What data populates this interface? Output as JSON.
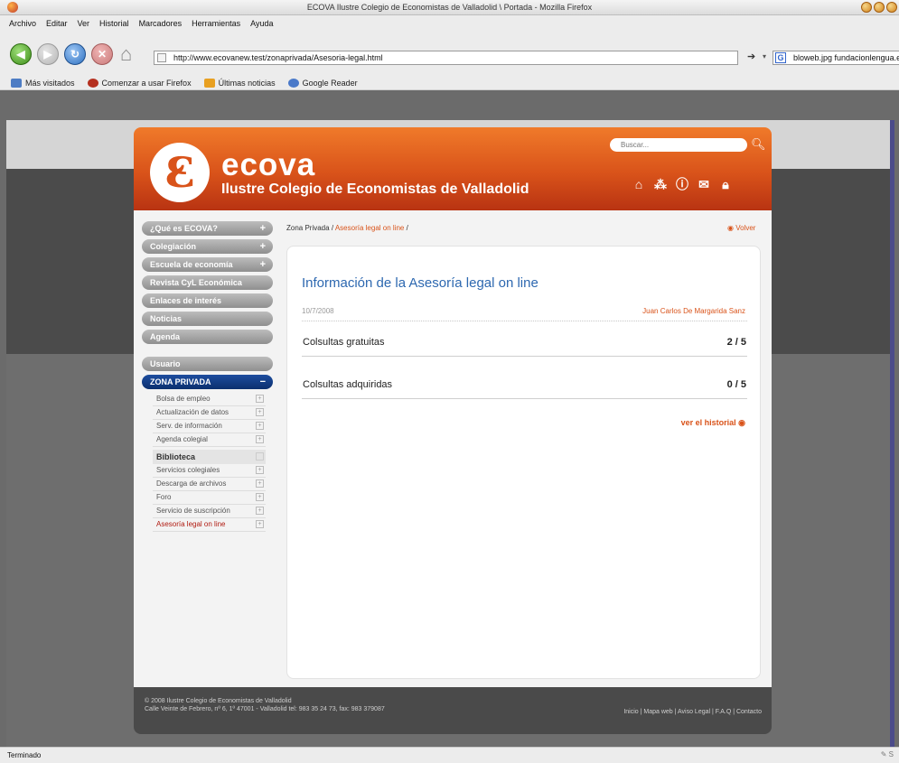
{
  "window": {
    "title": "ECOVA Ilustre Colegio de Economistas de Valladolid \\ Portada - Mozilla Firefox"
  },
  "menu": [
    "Archivo",
    "Editar",
    "Ver",
    "Historial",
    "Marcadores",
    "Herramientas",
    "Ayuda"
  ],
  "nav": {
    "url": "http://www.ecovanew.test/zonaprivada/Asesoria-legal.html",
    "search_text": "bloweb.jpg fundacionlengua.es"
  },
  "bookmarks": [
    "Más visitados",
    "Comenzar a usar Firefox",
    "Últimas noticias",
    "Google Reader"
  ],
  "site": {
    "brand": "ecova",
    "subtitle": "Ilustre Colegio de Economistas de Valladolid",
    "search_placeholder": "Buscar...",
    "main_nav": [
      "¿Qué es ECOVA?",
      "Colegiación",
      "Escuela de economía",
      "Revista CyL Económica",
      "Enlaces de interés",
      "Noticias",
      "Agenda"
    ],
    "user_label": "Usuario",
    "private_label": "ZONA PRIVADA",
    "private_items": [
      "Bolsa de empleo",
      "Actualización de datos",
      "Serv. de información",
      "Agenda colegial"
    ],
    "library_label": "Biblioteca",
    "library_items": [
      "Servicios colegiales",
      "Descarga de archivos",
      "Foro",
      "Servicio de suscripción",
      "Asesoría legal on line"
    ],
    "breadcrumb": {
      "home": "Zona Privada",
      "sep": "/",
      "current": "Asesoría legal on line"
    },
    "volver": "Volver",
    "content": {
      "title": "Información de la Asesoría legal on line",
      "date": "10/7/2008",
      "author": "Juan Carlos De Margarida Sanz",
      "rows": [
        {
          "label": "Colsultas gratuitas",
          "value": "2 / 5"
        },
        {
          "label": "Colsultas adquiridas",
          "value": "0 / 5"
        }
      ],
      "history_link": "ver el historial"
    },
    "footer": {
      "copy_line1": "© 2008 Ilustre Colegio de Economistas de Valladolid",
      "copy_line2": "Calle Veinte de Febrero, nº 6, 1º 47001 - Valladolid tel: 983 35 24 73, fax: 983 379087",
      "links": "Inicio | Mapa web | Aviso Legal | F.A.Q | Contacto"
    }
  },
  "status": {
    "text": "Terminado"
  }
}
